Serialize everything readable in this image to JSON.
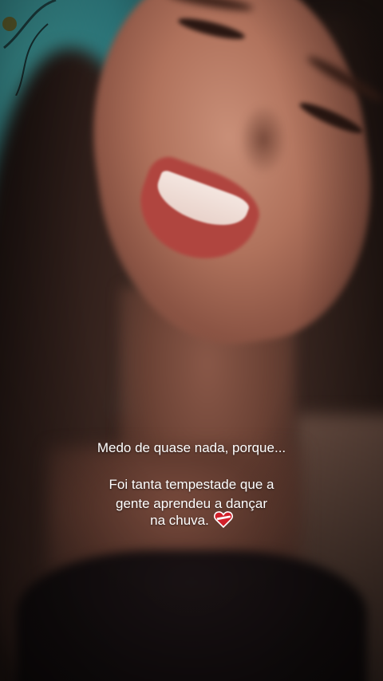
{
  "caption": {
    "line1": "Medo de quase nada, porque...",
    "line2": "Foi tanta tempestade que a",
    "line3": "gente aprendeu a dançar",
    "line4": "na chuva."
  },
  "icons": {
    "heart": "heart-icon"
  },
  "colors": {
    "caption_text": "#ffffff",
    "heart_red": "#d1202a",
    "heart_white": "#ffffff"
  }
}
